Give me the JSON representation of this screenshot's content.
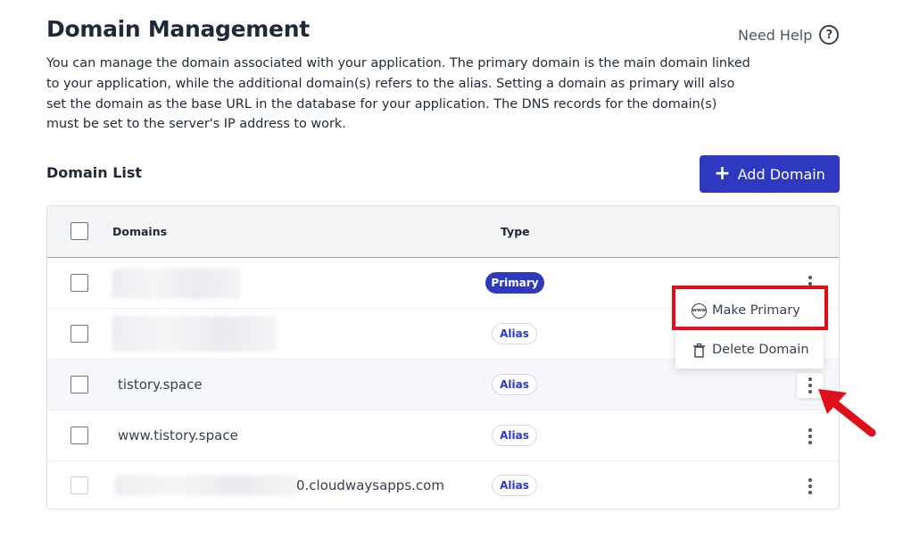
{
  "header": {
    "title": "Domain Management",
    "help_label": "Need Help",
    "description": "You can manage the domain associated with your application. The primary domain is the main domain linked to your application, while the additional domain(s) refers to the alias. Setting a domain as primary will also set the domain as the base URL in the database for your application. The DNS records for the domain(s) must be set to the server's IP address to work."
  },
  "domain_list": {
    "title": "Domain List",
    "add_button_label": "Add Domain",
    "columns": {
      "domains": "Domains",
      "type": "Type"
    },
    "rows": [
      {
        "domain": "",
        "type": "Primary"
      },
      {
        "domain": "",
        "type": "Alias"
      },
      {
        "domain": "tistory.space",
        "type": "Alias"
      },
      {
        "domain": "www.tistory.space",
        "type": "Alias"
      },
      {
        "domain": "0.cloudwaysapps.com",
        "type": "Alias"
      }
    ]
  },
  "context_menu": {
    "make_primary_label": "Make Primary",
    "delete_label": "Delete Domain"
  },
  "colors": {
    "accent": "#2f39bf",
    "highlight": "#e0101a"
  }
}
